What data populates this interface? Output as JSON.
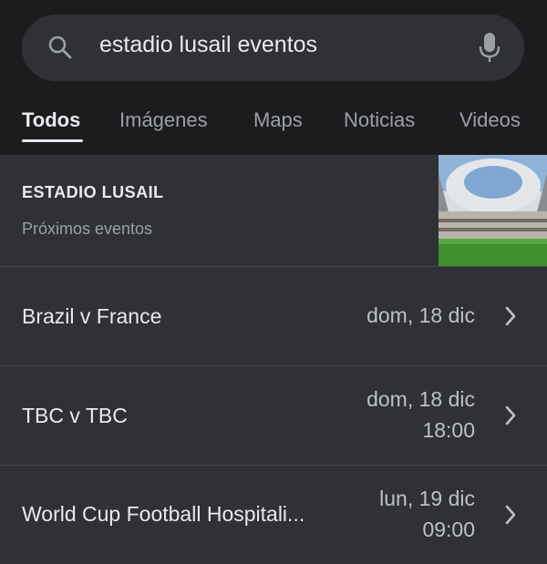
{
  "search": {
    "query": "estadio lusail eventos"
  },
  "tabs": [
    {
      "label": "Todos"
    },
    {
      "label": "Imágenes"
    },
    {
      "label": "Maps"
    },
    {
      "label": "Noticias"
    },
    {
      "label": "Videos"
    }
  ],
  "venue": {
    "title": "ESTADIO LUSAIL",
    "subtitle": "Próximos eventos"
  },
  "events": [
    {
      "name": "Brazil v France",
      "date": "dom, 18 dic",
      "time": ""
    },
    {
      "name": "TBC v TBC",
      "date": "dom, 18 dic",
      "time": "18:00"
    },
    {
      "name": "World Cup Football Hospitali...",
      "date": "lun, 19 dic",
      "time": "09:00"
    }
  ],
  "colors": {
    "background": "#303134",
    "topbar": "#1c1c1e",
    "text_primary": "#e8eaed",
    "text_secondary": "#9aa0a6"
  }
}
